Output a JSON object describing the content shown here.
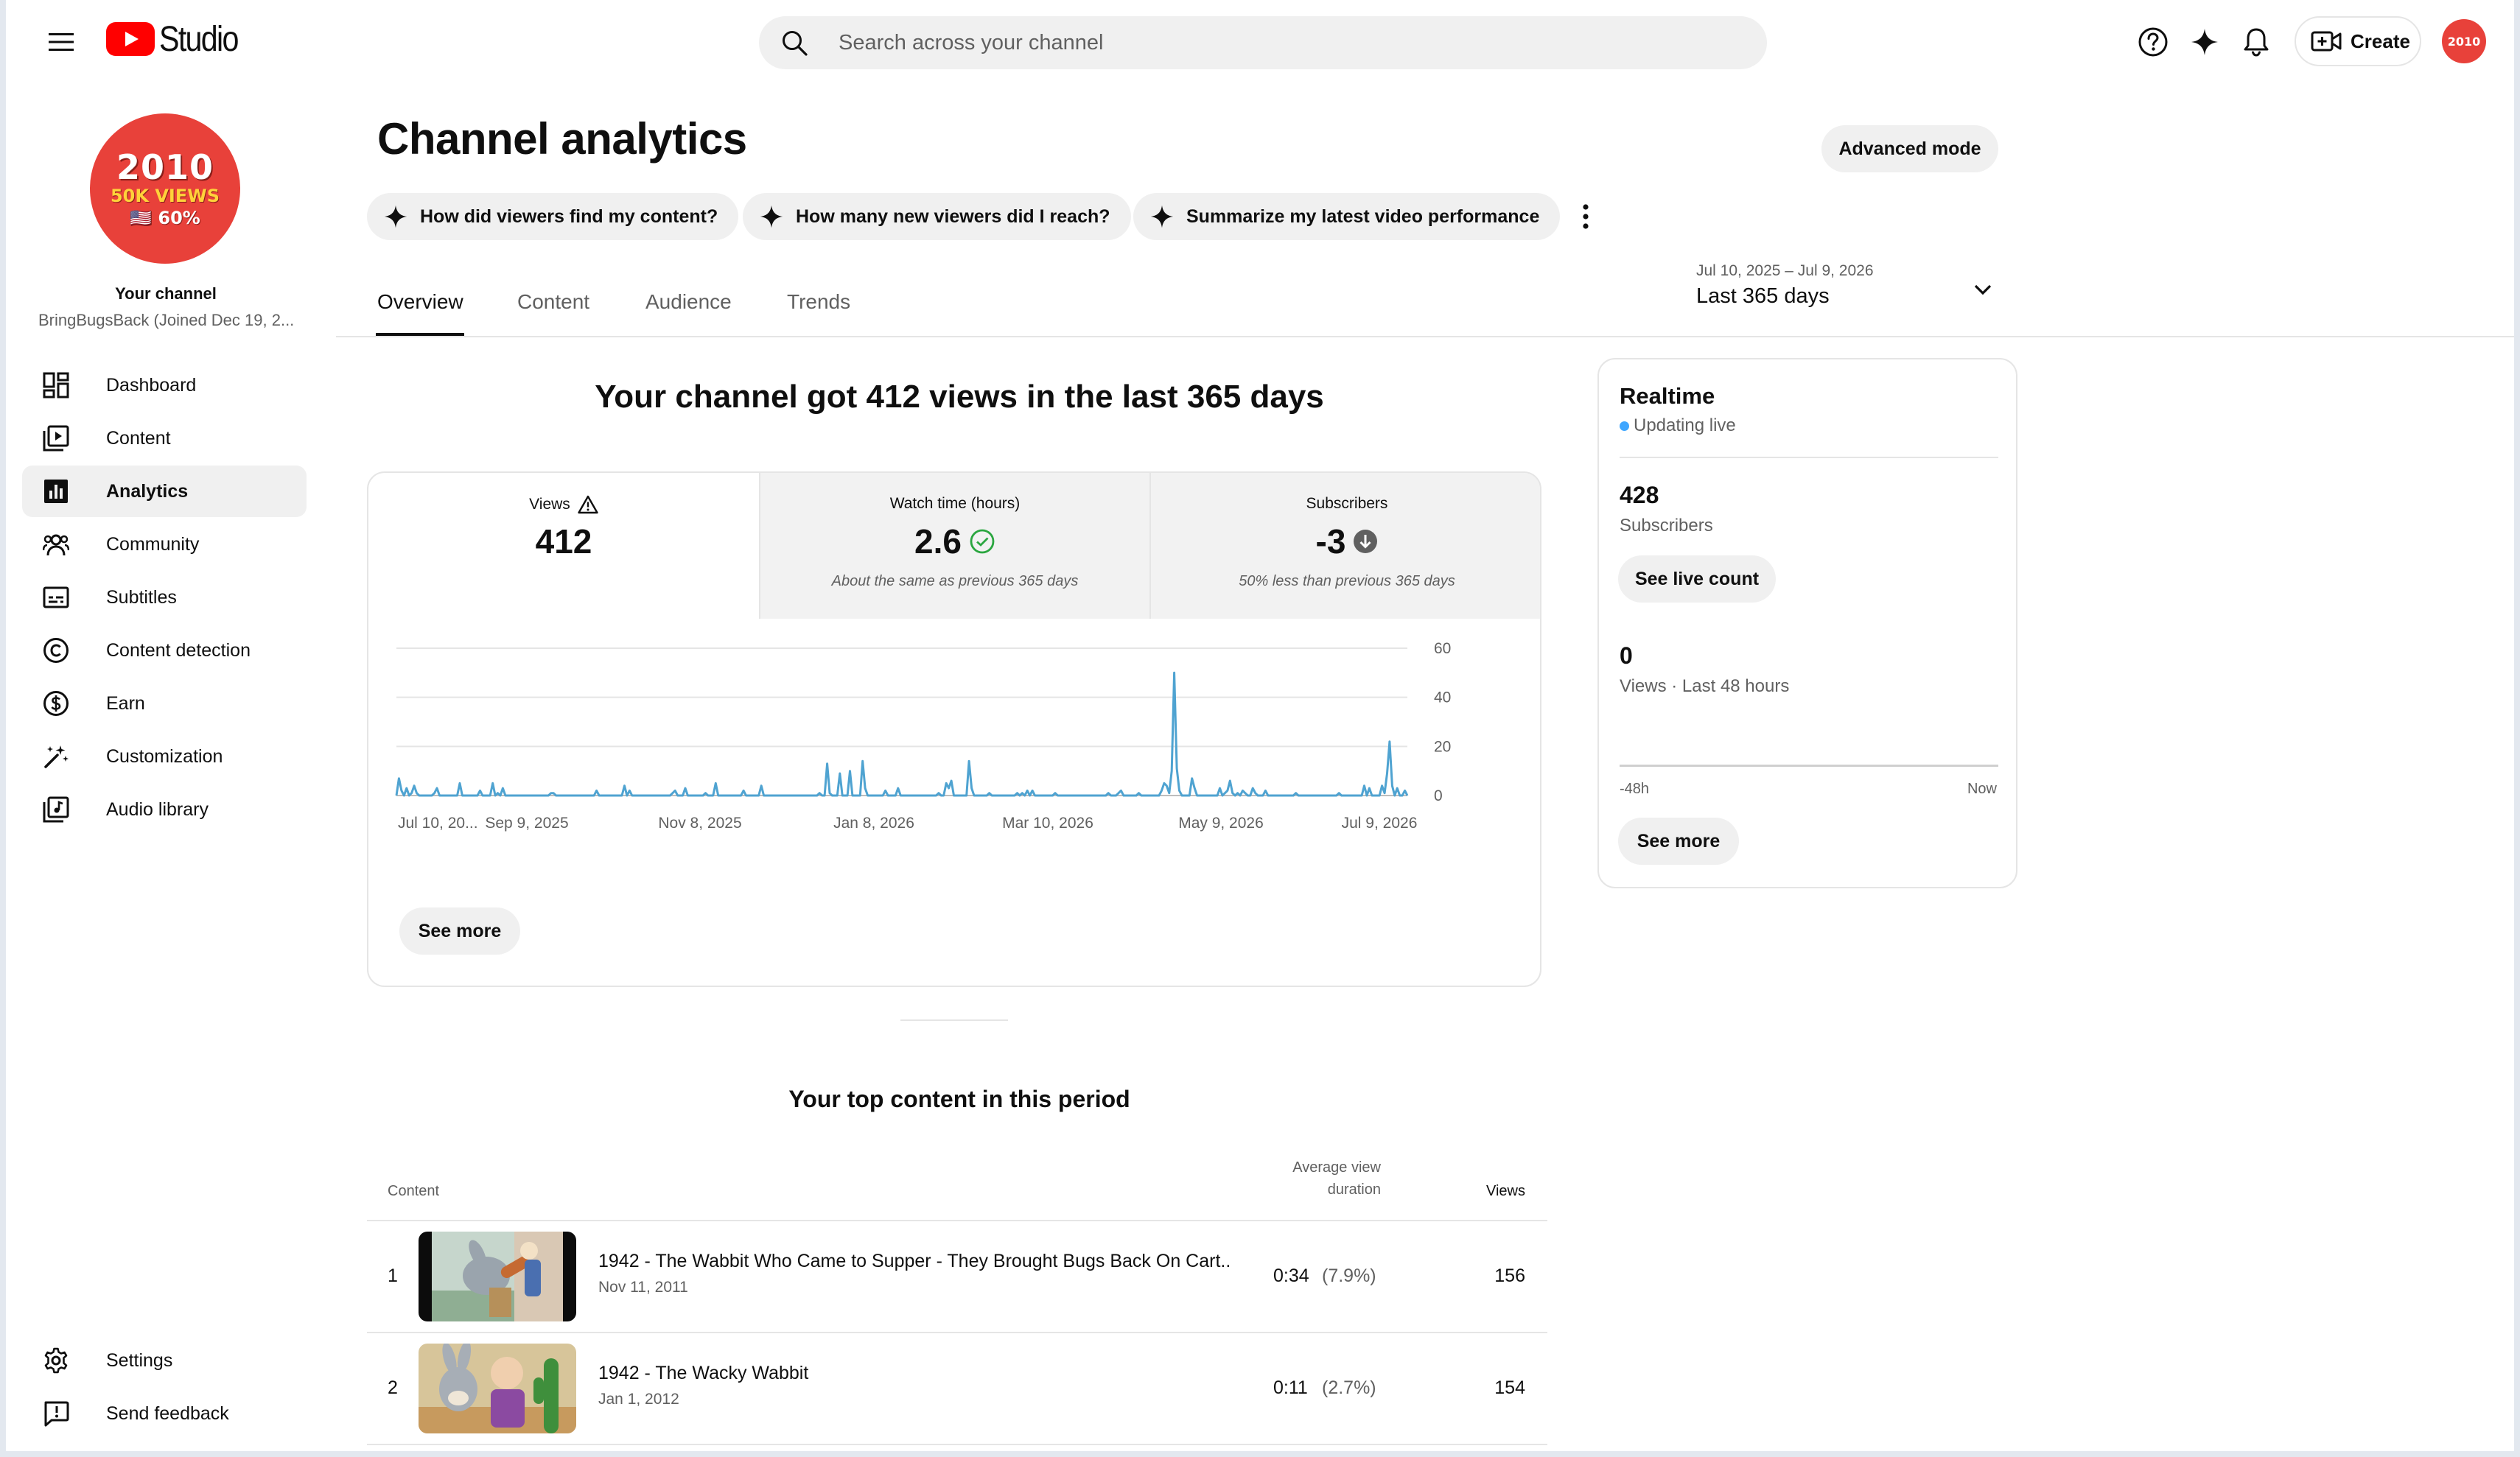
{
  "header": {
    "logo_text": "Studio",
    "search_placeholder": "Search across your channel",
    "create_label": "Create",
    "avatar_text": "2010"
  },
  "sidebar": {
    "avatar": {
      "line1": "2010",
      "line2": "50K VIEWS",
      "line3": "🇺🇸 60%"
    },
    "your_channel": "Your channel",
    "channel_handle": "BringBugsBack (Joined Dec 19, 2...",
    "items": [
      {
        "label": "Dashboard",
        "icon": "dashboard-icon"
      },
      {
        "label": "Content",
        "icon": "content-icon"
      },
      {
        "label": "Analytics",
        "icon": "analytics-icon",
        "active": true
      },
      {
        "label": "Community",
        "icon": "community-icon"
      },
      {
        "label": "Subtitles",
        "icon": "subtitles-icon"
      },
      {
        "label": "Content detection",
        "icon": "copyright-icon"
      },
      {
        "label": "Earn",
        "icon": "dollar-icon"
      },
      {
        "label": "Customization",
        "icon": "magic-wand-icon"
      },
      {
        "label": "Audio library",
        "icon": "audio-library-icon"
      }
    ],
    "bottom_items": [
      {
        "label": "Settings",
        "icon": "gear-icon"
      },
      {
        "label": "Send feedback",
        "icon": "feedback-icon"
      }
    ]
  },
  "main": {
    "title": "Channel analytics",
    "advanced_mode": "Advanced mode",
    "chips": [
      "How did viewers find my content?",
      "How many new viewers did I reach?",
      "Summarize my latest video performance"
    ],
    "tabs": [
      "Overview",
      "Content",
      "Audience",
      "Trends"
    ],
    "active_tab": "Overview",
    "date_range": "Jul 10, 2025 – Jul 9, 2026",
    "date_label": "Last 365 days",
    "headline": "Your channel got 412 views in the last 365 days",
    "metrics": [
      {
        "label": "Views",
        "value": "412",
        "note": ""
      },
      {
        "label": "Watch time (hours)",
        "value": "2.6",
        "note": "About the same as previous 365 days"
      },
      {
        "label": "Subscribers",
        "value": "-3",
        "note": "50% less than previous 365 days"
      }
    ],
    "see_more": "See more"
  },
  "chart_data": {
    "type": "line",
    "title": "",
    "xlabel": "",
    "ylabel": "",
    "x_tick_labels": [
      "Jul 10, 20...",
      "Sep 9, 2025",
      "Nov 8, 2025",
      "Jan 8, 2026",
      "Mar 10, 2026",
      "May 9, 2026",
      "Jul 9, 2026"
    ],
    "y_ticks": [
      0,
      20,
      40,
      60
    ],
    "ylim": [
      0,
      60
    ],
    "grid": true,
    "color": "#4fa3d1",
    "series": [
      {
        "name": "",
        "values": [
          0,
          7,
          2,
          0,
          3,
          0,
          1,
          4,
          1,
          0,
          0,
          0,
          0,
          0,
          0,
          1,
          3,
          0,
          0,
          0,
          0,
          0,
          0,
          0,
          0,
          5,
          0,
          0,
          0,
          0,
          0,
          0,
          0,
          2,
          0,
          0,
          0,
          0,
          5,
          0,
          1,
          0,
          3,
          0,
          0,
          0,
          0,
          0,
          0,
          0,
          0,
          0,
          0,
          0,
          0,
          0,
          0,
          0,
          0,
          0,
          0,
          1,
          1,
          0,
          0,
          0,
          0,
          0,
          0,
          0,
          0,
          0,
          0,
          0,
          0,
          0,
          0,
          0,
          0,
          2,
          0,
          0,
          0,
          0,
          0,
          0,
          0,
          0,
          0,
          0,
          4,
          0,
          2,
          0,
          0,
          0,
          0,
          0,
          0,
          0,
          0,
          0,
          0,
          0,
          0,
          0,
          0,
          0,
          0,
          1,
          2,
          0,
          0,
          0,
          3,
          0,
          0,
          0,
          0,
          0,
          0,
          0,
          1,
          0,
          0,
          0,
          5,
          0,
          0,
          0,
          0,
          0,
          0,
          0,
          0,
          0,
          0,
          2,
          0,
          0,
          0,
          0,
          0,
          0,
          4,
          0,
          0,
          0,
          0,
          0,
          0,
          0,
          0,
          0,
          0,
          0,
          0,
          0,
          0,
          0,
          0,
          0,
          0,
          0,
          0,
          0,
          0,
          1,
          0,
          0,
          13,
          1,
          0,
          0,
          0,
          9,
          0,
          0,
          0,
          10,
          0,
          0,
          0,
          0,
          14,
          3,
          0,
          0,
          0,
          0,
          0,
          0,
          0,
          2,
          0,
          0,
          0,
          0,
          3,
          0,
          0,
          0,
          0,
          0,
          0,
          0,
          0,
          0,
          0,
          0,
          0,
          0,
          0,
          0,
          1,
          0,
          0,
          5,
          3,
          6,
          0,
          0,
          0,
          0,
          0,
          0,
          14,
          3,
          0,
          0,
          0,
          0,
          0,
          0,
          1,
          0,
          0,
          0,
          0,
          0,
          0,
          0,
          0,
          0,
          0,
          1,
          0,
          1,
          0,
          2,
          0,
          2,
          0,
          0,
          0,
          0,
          0,
          0,
          0,
          0,
          1,
          0,
          0,
          0,
          0,
          0,
          0,
          0,
          0,
          0,
          0,
          0,
          0,
          0,
          0,
          0,
          0,
          0,
          0,
          0,
          0,
          1,
          0,
          0,
          0,
          1,
          2,
          0,
          0,
          0,
          0,
          0,
          0,
          1,
          0,
          0,
          0,
          0,
          0,
          0,
          0,
          0,
          2,
          5,
          4,
          1,
          10,
          50,
          11,
          2,
          0,
          0,
          0,
          0,
          7,
          3,
          0,
          0,
          0,
          0,
          0,
          0,
          0,
          0,
          0,
          3,
          0,
          1,
          2,
          6,
          1,
          0,
          1,
          0,
          2,
          1,
          0,
          0,
          3,
          1,
          0,
          0,
          0,
          2,
          0,
          0,
          0,
          0,
          0,
          0,
          0,
          0,
          0,
          0,
          0,
          1,
          0,
          0,
          0,
          0,
          0,
          0,
          0,
          0,
          0,
          0,
          0,
          0,
          0,
          0,
          0,
          0,
          1,
          0,
          0,
          0,
          0,
          0,
          0,
          0,
          0,
          0,
          4,
          0,
          3,
          0,
          0,
          0,
          0,
          4,
          1,
          9,
          22,
          4,
          0,
          3,
          0,
          0,
          2,
          0
        ]
      }
    ]
  },
  "realtime": {
    "title": "Realtime",
    "status": "Updating live",
    "subscribers_value": "428",
    "subscribers_label": "Subscribers",
    "see_live_count": "See live count",
    "views_value": "0",
    "views_label": "Views · Last 48 hours",
    "axis_start": "-48h",
    "axis_end": "Now",
    "see_more": "See more"
  },
  "top_content": {
    "heading": "Your top content in this period",
    "col_content": "Content",
    "col_avg_line1": "Average view",
    "col_avg_line2": "duration",
    "col_views": "Views",
    "rows": [
      {
        "rank": "1",
        "title": "1942 - The Wabbit Who Came to Supper - They Brought Bugs Back On Cart...",
        "date": "Nov 11, 2011",
        "duration": "0:34",
        "pct": "(7.9%)",
        "views": "156"
      },
      {
        "rank": "2",
        "title": "1942 - The Wacky Wabbit",
        "date": "Jan 1, 2012",
        "duration": "0:11",
        "pct": "(2.7%)",
        "views": "154"
      }
    ]
  },
  "colors": {
    "brand_red": "#ff0000",
    "avatar_red": "#e8413a",
    "chart_line": "#4fa3d1",
    "live_dot": "#3ea6ff",
    "success_green": "#2ba640"
  }
}
